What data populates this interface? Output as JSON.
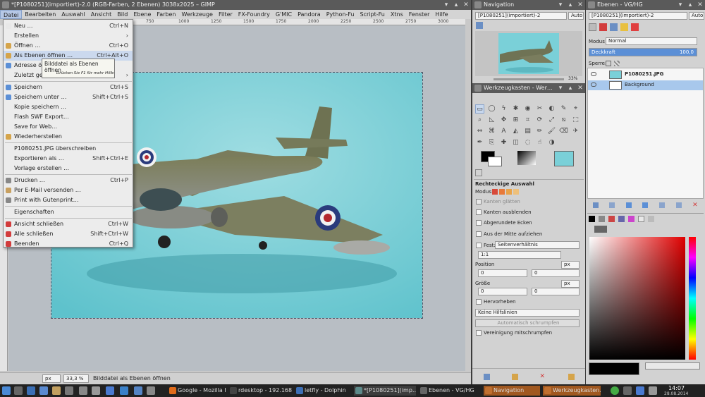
{
  "main": {
    "title": "*[P1080251](importiert)-2.0 (RGB-Farben, 2 Ebenen) 3038x2025 – GIMP",
    "menubar": [
      "Datei",
      "Bearbeiten",
      "Auswahl",
      "Ansicht",
      "Bild",
      "Ebene",
      "Farben",
      "Werkzeuge",
      "Filter",
      "FX-Foundry",
      "G'MIC",
      "Pandora",
      "Python-Fu",
      "Script-Fu",
      "Xtns",
      "Fenster",
      "Hilfe"
    ],
    "ruler_marks": [
      "750",
      "1000",
      "1250",
      "1500",
      "1750",
      "2000",
      "2250",
      "2500",
      "2750",
      "3000"
    ],
    "status": {
      "unit": "px",
      "zoom": "33,3 %",
      "message": "Bilddatei als Ebenen öffnen"
    }
  },
  "file_menu": [
    {
      "label": "Neu …",
      "shortcut": "Ctrl+N",
      "icon": "new-icon"
    },
    {
      "label": "Erstellen",
      "shortcut": "›",
      "icon": ""
    },
    {
      "label": "Öffnen …",
      "shortcut": "Ctrl+O",
      "icon": "open-icon"
    },
    {
      "label": "Als Ebenen öffnen …",
      "shortcut": "Ctrl+Alt+O",
      "icon": "open-layers-icon",
      "highlight": true
    },
    {
      "label": "Adresse öffnen …",
      "shortcut": "",
      "icon": "globe-icon"
    },
    {
      "label": "Zuletzt geöffnet",
      "shortcut": "›",
      "icon": ""
    },
    {
      "label": "Speichern",
      "shortcut": "Ctrl+S",
      "icon": "save-icon",
      "sep": true
    },
    {
      "label": "Speichern unter …",
      "shortcut": "Shift+Ctrl+S",
      "icon": "save-as-icon"
    },
    {
      "label": "Kopie speichern …",
      "shortcut": "",
      "icon": ""
    },
    {
      "label": "Flash SWF Export…",
      "shortcut": "",
      "icon": ""
    },
    {
      "label": "Save for Web…",
      "shortcut": "",
      "icon": ""
    },
    {
      "label": "Wiederherstellen",
      "shortcut": "",
      "icon": "revert-icon"
    },
    {
      "label": "P1080251.JPG überschreiben",
      "shortcut": "",
      "icon": "",
      "sep": true
    },
    {
      "label": "Exportieren als …",
      "shortcut": "Shift+Ctrl+E",
      "icon": ""
    },
    {
      "label": "Vorlage erstellen …",
      "shortcut": "",
      "icon": ""
    },
    {
      "label": "Drucken …",
      "shortcut": "Ctrl+P",
      "icon": "print-icon",
      "sep": true
    },
    {
      "label": "Per E-Mail versenden …",
      "shortcut": "",
      "icon": "mail-icon"
    },
    {
      "label": "Print with Gutenprint…",
      "shortcut": "",
      "icon": "print-icon"
    },
    {
      "label": "Eigenschaften",
      "shortcut": "",
      "icon": "",
      "sep": true
    },
    {
      "label": "Ansicht schließen",
      "shortcut": "Ctrl+W",
      "icon": "close-red-icon",
      "sep": true
    },
    {
      "label": "Alle schließen",
      "shortcut": "Shift+Ctrl+W",
      "icon": "close-red-icon"
    },
    {
      "label": "Beenden",
      "shortcut": "Ctrl+Q",
      "icon": "quit-red-icon"
    }
  ],
  "tooltip": {
    "title": "Bilddatei als Ebenen öffnen",
    "hint": "Drücken Sie F1 für mehr Hilfe"
  },
  "navigation": {
    "title": "Navigation",
    "image_select": "[P1080251](importiert)-2",
    "auto": "Auto",
    "zoom": "33%"
  },
  "toolbox": {
    "title": "Werkzeugkasten - Wer…",
    "tool_title": "Rechteckige Auswahl",
    "modus_label": "Modus:",
    "options": {
      "kanten_glaetten": "Kanten glätten",
      "kanten_ausblenden": "Kanten ausblenden",
      "abgerundete_ecken": "Abgerundete Ecken",
      "aus_der_mitte": "Aus der Mitte aufziehen",
      "fest": "Fest:",
      "fest_value": "Seitenverhältnis",
      "ratio": "1:1",
      "position": "Position",
      "pos_unit": "px",
      "pos_x": "0",
      "pos_y": "0",
      "groesse": "Größe",
      "size_unit": "px",
      "size_w": "0",
      "size_h": "0",
      "hervorheben": "Hervorheben",
      "hilfslinien": "Keine Hilfslinien",
      "auto_schrumpfen": "Automatisch schrumpfen",
      "vereinigung": "Vereinigung mitschrumpfen"
    }
  },
  "layers": {
    "title": "Ebenen - VG/HG",
    "image_select": "[P1080251](importiert)-2",
    "auto": "Auto",
    "modus_label": "Modus",
    "modus_value": "Normal",
    "deckkraft_label": "Deckkraft",
    "deckkraft_value": "100,0",
    "deckkraft_fraction": 1.0,
    "sperre_label": "Sperre:",
    "items": [
      {
        "name": "P1080251.JPG",
        "selected": false
      },
      {
        "name": "Background",
        "selected": true
      }
    ]
  },
  "taskbar": {
    "tasks": [
      {
        "label": "Google - Mozilla Fi…",
        "color": "#e06b1a"
      },
      {
        "label": "rdesktop - 192.168.…",
        "color": "#444"
      },
      {
        "label": "letfly - Dolphin",
        "color": "#3d6fb5"
      },
      {
        "label": "*[P1080251](imp…",
        "color": "#5d8a8a"
      },
      {
        "label": "Ebenen - VG/HG",
        "color": "#666"
      },
      {
        "label": "Navigation",
        "color": "#c07030"
      },
      {
        "label": "Werkzeugkasten…",
        "color": "#c07030"
      }
    ],
    "time": "14:07",
    "date": "28.08.2014"
  },
  "colors": {
    "accent": "#5b8fd6",
    "selection": "#a8c8ec",
    "close_red": "#d23c3c"
  }
}
